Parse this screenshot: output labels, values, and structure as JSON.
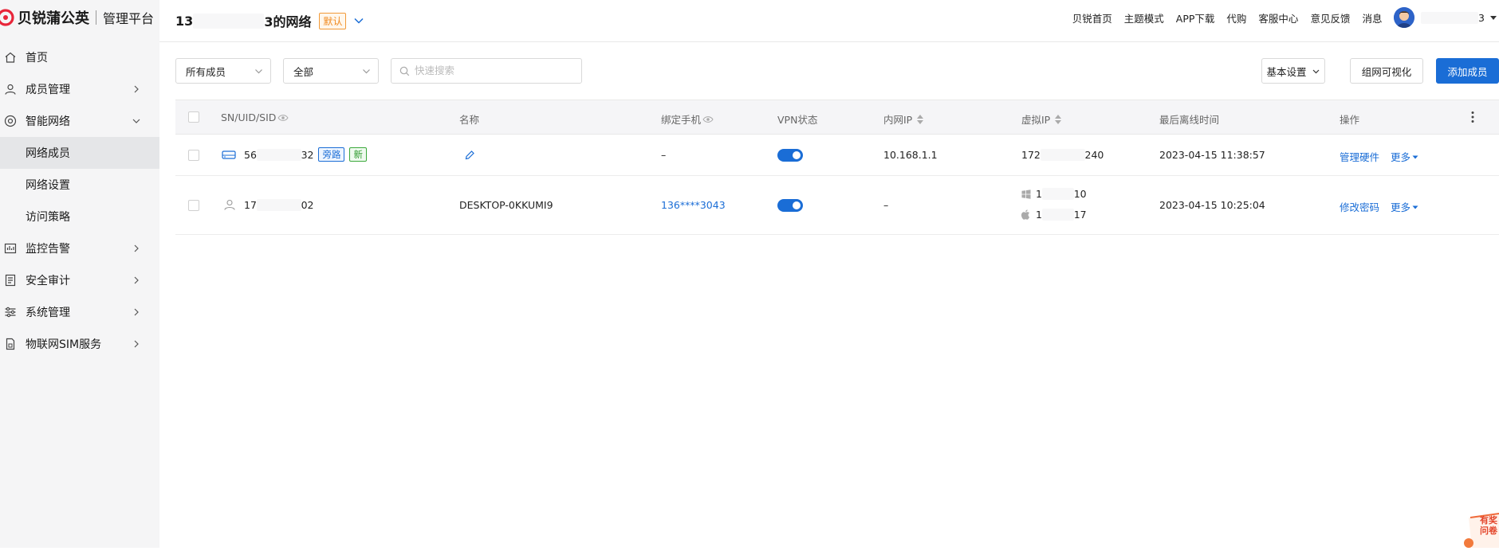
{
  "brand": {
    "name": "贝锐蒲公英",
    "subtitle": "管理平台"
  },
  "sidebar": {
    "items": [
      {
        "label": "首页",
        "icon": "home-icon"
      },
      {
        "label": "成员管理",
        "icon": "user-icon"
      },
      {
        "label": "智能网络",
        "icon": "network-icon",
        "expanded": true,
        "children": [
          {
            "label": "网络成员",
            "active": true
          },
          {
            "label": "网络设置"
          },
          {
            "label": "访问策略"
          }
        ]
      },
      {
        "label": "监控告警",
        "icon": "monitor-icon"
      },
      {
        "label": "安全审计",
        "icon": "audit-icon"
      },
      {
        "label": "系统管理",
        "icon": "settings-icon"
      },
      {
        "label": "物联网SIM服务",
        "icon": "sim-icon"
      }
    ]
  },
  "header": {
    "title_prefix": "13",
    "title_suffix": "3的网络",
    "default_badge": "默认",
    "links": [
      "贝锐首页",
      "主题模式",
      "APP下载",
      "代购",
      "客服中心",
      "意见反馈",
      "消息"
    ],
    "user_suffix": "3"
  },
  "toolbar": {
    "member_filter": "所有成员",
    "type_filter": "全部",
    "search_placeholder": "快速搜索",
    "basic_settings": "基本设置",
    "visualize": "组网可视化",
    "add_member": "添加成员"
  },
  "table": {
    "columns": {
      "sn": "SN/UID/SID",
      "name": "名称",
      "phone": "绑定手机",
      "vpn": "VPN状态",
      "lan_ip": "内网IP",
      "virtual_ip": "虚拟IP",
      "last_offline": "最后离线时间",
      "actions": "操作"
    },
    "rows": [
      {
        "sn_prefix": "56",
        "sn_suffix": "32",
        "tags": [
          "旁路",
          "新"
        ],
        "name": "",
        "phone": "–",
        "vpn_on": true,
        "lan_ip": "10.168.1.1",
        "vip_prefix": "172",
        "vip_suffix": "240",
        "last_offline": "2023-04-15 11:38:57",
        "action": "管理硬件",
        "more": "更多"
      },
      {
        "sn_prefix": "17",
        "sn_suffix": "02",
        "name": "DESKTOP-0KKUMI9",
        "phone": "136****3043",
        "vpn_on": true,
        "lan_ip": "–",
        "vip_win_prefix": "1",
        "vip_win_suffix": "10",
        "vip_mac_prefix": "1",
        "vip_mac_suffix": "17",
        "last_offline": "2023-04-15 10:25:04",
        "action": "修改密码",
        "more": "更多"
      }
    ]
  },
  "survey": {
    "line1": "有奖",
    "line2": "问卷"
  },
  "colors": {
    "primary": "#1a6dd6",
    "brand_red": "#e8263a",
    "badge_orange": "#f08a20"
  }
}
